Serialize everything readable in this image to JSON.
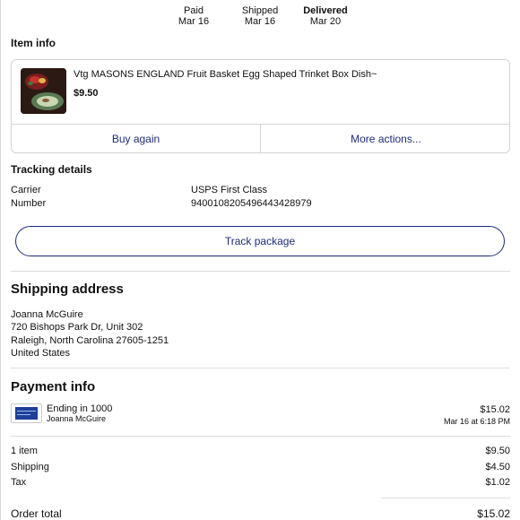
{
  "progress": {
    "steps": [
      {
        "label": "Paid",
        "date": "Mar 16"
      },
      {
        "label": "Shipped",
        "date": "Mar 16"
      },
      {
        "label": "Delivered",
        "date": "Mar 20"
      }
    ]
  },
  "item_info": {
    "title": "Item info",
    "item": {
      "name": "Vtg MASONS ENGLAND Fruit Basket Egg Shaped Trinket Box Dish~",
      "price": "$9.50"
    },
    "buy_again": "Buy again",
    "more_actions": "More actions..."
  },
  "tracking": {
    "title": "Tracking details",
    "carrier_label": "Carrier",
    "carrier_value": "USPS First Class",
    "number_label": "Number",
    "number_value": "9400108205496443428979",
    "button": "Track package"
  },
  "shipping": {
    "title": "Shipping address",
    "name": "Joanna McGuire",
    "line1": "720 Bishops Park Dr, Unit 302",
    "line2": "Raleigh, North Carolina 27605-1251",
    "country": "United States"
  },
  "payment": {
    "title": "Payment info",
    "card_ending": "Ending in 1000",
    "card_holder": "Joanna McGuire",
    "amount": "$15.02",
    "paid_at": "Mar 16 at 6:18 PM",
    "items_label": "1 item",
    "items_value": "$9.50",
    "shipping_label": "Shipping",
    "shipping_value": "$4.50",
    "tax_label": "Tax",
    "tax_value": "$1.02",
    "total_label": "Order total",
    "total_value": "$15.02"
  },
  "colors": {
    "link_blue": "#1d2b7a",
    "divider": "#dcdcdc",
    "card_blue": "#1e3f9a"
  }
}
